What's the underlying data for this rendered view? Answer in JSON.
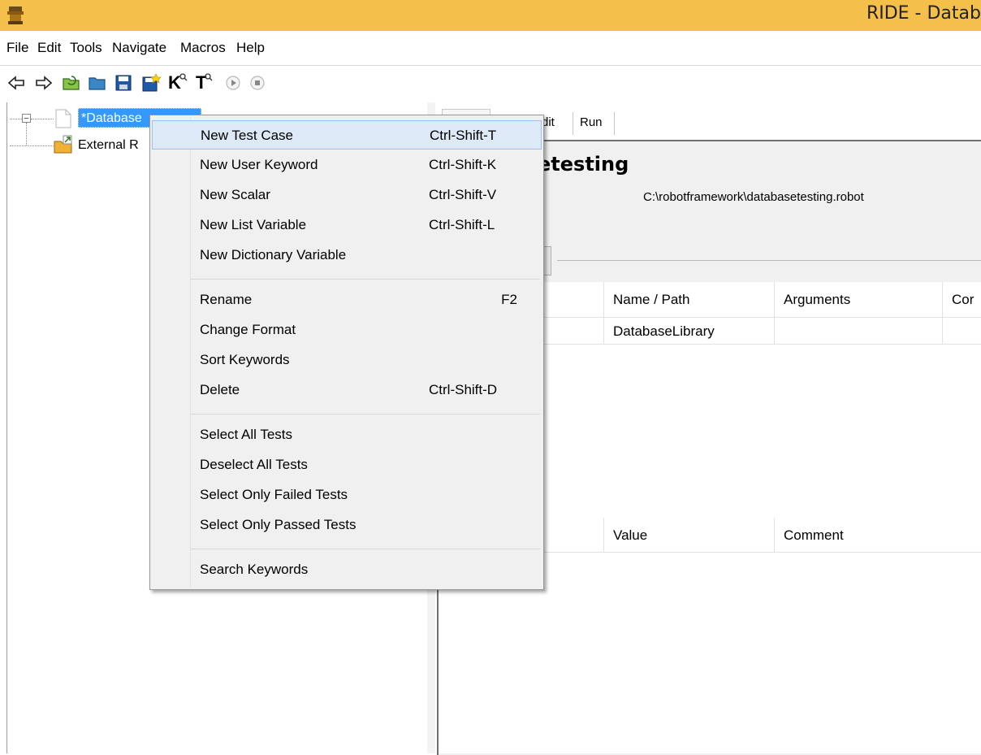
{
  "window": {
    "title": "RIDE - Datab",
    "app_icon": "ride-app-icon"
  },
  "menubar": {
    "items": [
      "File",
      "Edit",
      "Tools",
      "Navigate",
      "Macros",
      "Help"
    ]
  },
  "toolbar": {
    "icons": [
      "back-arrow-icon",
      "forward-arrow-icon",
      "open-directory-icon",
      "open-folder-icon",
      "save-icon",
      "save-all-icon",
      "search-keyword-icon",
      "search-test-icon",
      "run-icon",
      "stop-icon"
    ],
    "keyword_search_glyph": "K",
    "test_search_glyph": "T"
  },
  "tree": {
    "root_label": "*Database",
    "child_label": "External R"
  },
  "tabs": {
    "items": [
      "dit",
      "Run"
    ]
  },
  "editor": {
    "title_fragment": "etesting",
    "source_path": "C:\\robotframework\\databasetesting.robot"
  },
  "imports_table": {
    "columns": [
      "Name / Path",
      "Arguments",
      "Cor"
    ],
    "rows": [
      {
        "name": "DatabaseLibrary"
      }
    ]
  },
  "variables_table": {
    "columns": [
      "Value",
      "Comment"
    ]
  },
  "context_menu": {
    "groups": [
      [
        {
          "label": "New Test Case",
          "shortcut": "Ctrl-Shift-T",
          "highlighted": true
        },
        {
          "label": "New User Keyword",
          "shortcut": "Ctrl-Shift-K"
        },
        {
          "label": "New Scalar",
          "shortcut": "Ctrl-Shift-V"
        },
        {
          "label": "New List Variable",
          "shortcut": "Ctrl-Shift-L"
        },
        {
          "label": "New Dictionary Variable",
          "shortcut": ""
        }
      ],
      [
        {
          "label": "Rename",
          "shortcut": "F2"
        },
        {
          "label": "Change Format",
          "shortcut": ""
        },
        {
          "label": "Sort Keywords",
          "shortcut": ""
        },
        {
          "label": "Delete",
          "shortcut": "Ctrl-Shift-D"
        }
      ],
      [
        {
          "label": "Select All Tests",
          "shortcut": ""
        },
        {
          "label": "Deselect All Tests",
          "shortcut": ""
        },
        {
          "label": "Select Only Failed Tests",
          "shortcut": ""
        },
        {
          "label": "Select Only Passed Tests",
          "shortcut": ""
        }
      ],
      [
        {
          "label": "Search Keywords",
          "shortcut": ""
        }
      ]
    ]
  },
  "colors": {
    "titlebar": "#f5c04a",
    "selection": "#3399ff",
    "menu_highlight": "#dde9f7"
  }
}
